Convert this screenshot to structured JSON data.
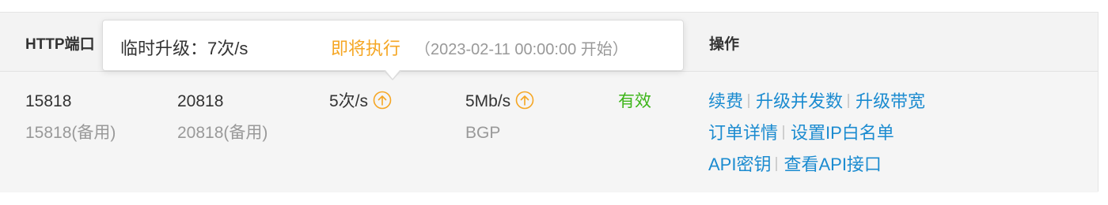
{
  "table": {
    "headers": {
      "http_port": "HTTP端口",
      "actions": "操作"
    },
    "row": {
      "http_port": "15818",
      "http_port_backup": "15818(备用)",
      "socks_port": "20818",
      "socks_port_backup": "20818(备用)",
      "concurrency": "5次/s",
      "bandwidth": "5Mb/s",
      "line_type": "BGP",
      "status": "有效",
      "actions": {
        "renew": "续费",
        "upgrade_concurrency": "升级并发数",
        "upgrade_bandwidth": "升级带宽",
        "order_details": "订单详情",
        "ip_whitelist": "设置IP白名单",
        "api_key": "API密钥",
        "view_api": "查看API接口"
      }
    }
  },
  "tooltip": {
    "temp_upgrade": "临时升级：7次/s",
    "status": "即将执行",
    "time": "（2023-02-11 00:00:00 开始）"
  },
  "colors": {
    "link": "#1b8bd0",
    "valid": "#3cb518",
    "pending": "#f5a623",
    "upgrade_icon": "#f5a623"
  },
  "icons": {
    "upgrade": "arrow-up-circle-icon"
  }
}
